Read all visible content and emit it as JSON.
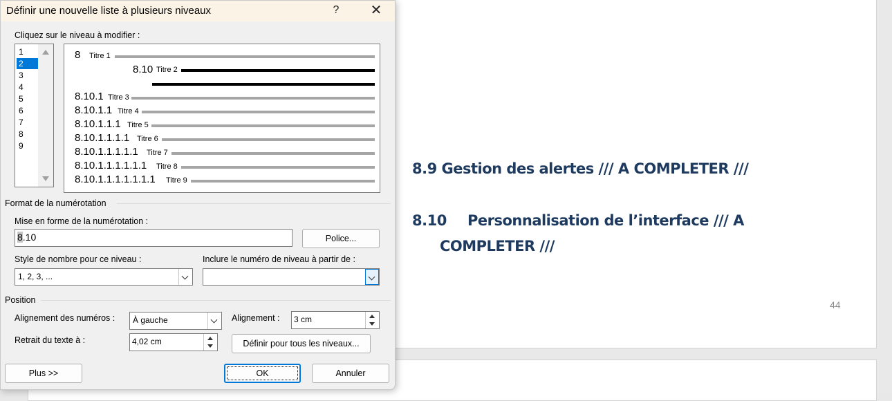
{
  "document": {
    "heading_89": "8.9 Gestion des alertes /// A COMPLETER ///",
    "heading_810_number": "8.10",
    "heading_810_text": "Personnalisation de l’interface /// A",
    "heading_810_continuation": "COMPLETER ///",
    "page_number": "44",
    "heading_color": "#1e3a5f"
  },
  "dialog": {
    "title": "Définir une nouvelle liste à plusieurs niveaux",
    "help_icon": "?",
    "close_icon": "✕",
    "click_level_label": "Cliquez sur le niveau à modifier :",
    "levels": [
      "1",
      "2",
      "3",
      "4",
      "5",
      "6",
      "7",
      "8",
      "9"
    ],
    "selected_level": "2",
    "preview": {
      "rows": [
        {
          "number": "8",
          "label": "Titre 1"
        },
        {
          "number": "8.10",
          "label": "Titre 2"
        },
        {
          "number": "8.10.1",
          "label": "Titre 3"
        },
        {
          "number": "8.10.1.1",
          "label": "Titre 4"
        },
        {
          "number": "8.10.1.1.1",
          "label": "Titre 5"
        },
        {
          "number": "8.10.1.1.1.1",
          "label": "Titre 6"
        },
        {
          "number": "8.10.1.1.1.1.1",
          "label": "Titre 7"
        },
        {
          "number": "8.10.1.1.1.1.1.1",
          "label": "Titre 8"
        },
        {
          "number": "8.10.1.1.1.1.1.1.1",
          "label": "Titre 9"
        }
      ]
    },
    "numbering_format_section": "Format de la numérotation",
    "number_format_label": "Mise en forme de la numérotation :",
    "number_format_value_first": "8",
    "number_format_value_rest": ".10",
    "font_button": "Police...",
    "number_style_label": "Style de nombre pour ce niveau :",
    "number_style_value": "1, 2, 3, ...",
    "include_level_label": "Inclure le numéro de niveau à partir de :",
    "include_level_value": "",
    "position_section": "Position",
    "alignment_numbers_label": "Alignement des numéros :",
    "alignment_numbers_value": "À gauche",
    "alignment_label": "Alignement :",
    "alignment_value": "3 cm",
    "text_indent_label": "Retrait du texte à :",
    "text_indent_value": "4,02 cm",
    "set_all_levels_button": "Définir pour tous les niveaux...",
    "more_button": "Plus >>",
    "ok_button": "OK",
    "cancel_button": "Annuler"
  },
  "colors": {
    "selection": "#0078d7",
    "titlebar": "#fcf3e7",
    "dialog_bg": "#f0f0f0"
  }
}
